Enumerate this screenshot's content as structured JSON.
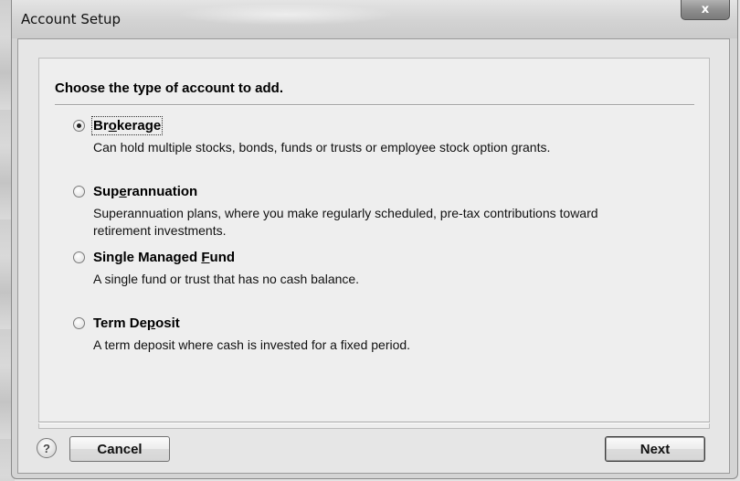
{
  "window": {
    "title": "Account Setup",
    "close_glyph": "x"
  },
  "prompt": {
    "title": "Choose the type of account to add."
  },
  "options": [
    {
      "label": "Brokerage",
      "accel_pre": "Br",
      "accel_key": "o",
      "accel_post": "kerage",
      "description": "Can hold multiple stocks, bonds, funds or trusts or employee stock option grants.",
      "selected": true
    },
    {
      "label": "Superannuation",
      "accel_pre": "Sup",
      "accel_key": "e",
      "accel_post": "rannuation",
      "description": "Superannuation plans, where you make regularly scheduled, pre-tax contributions toward retirement investments.",
      "selected": false
    },
    {
      "label": "Single Managed Fund",
      "accel_pre": "Single Managed ",
      "accel_key": "F",
      "accel_post": "und",
      "description": "A single fund or trust that has no cash balance.",
      "selected": false
    },
    {
      "label": "Term Deposit",
      "accel_pre": "Term De",
      "accel_key": "p",
      "accel_post": "osit",
      "description": "A term deposit where cash is invested for a fixed period.",
      "selected": false
    }
  ],
  "footer": {
    "help_glyph": "?",
    "cancel_label": "Cancel",
    "next_label": "Next"
  },
  "icons": {
    "help": "help-icon",
    "close": "close-icon",
    "radio": "radio-button"
  }
}
